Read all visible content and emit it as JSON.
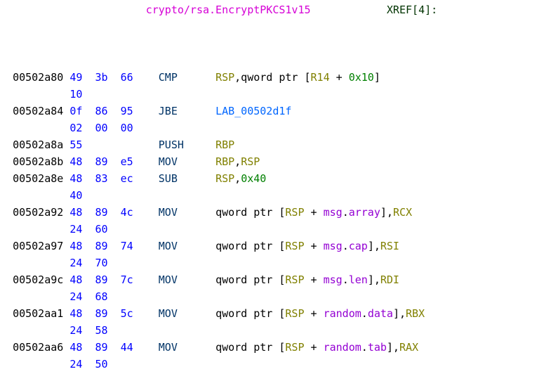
{
  "header": {
    "func_name": "crypto/rsa.EncryptPKCS1v15",
    "xref_label": "XREF[",
    "xref_count": "4",
    "xref_close": "]:"
  },
  "lines": [
    {
      "addr": "00502a80",
      "bytes1": "49  3b  66",
      "bytes2": "10",
      "mnem": "CMP",
      "ops": [
        {
          "t": "reg",
          "v": "RSP"
        },
        {
          "t": "plain",
          "v": ",qword ptr ["
        },
        {
          "t": "reg",
          "v": "R14"
        },
        {
          "t": "plain",
          "v": " + "
        },
        {
          "t": "lit",
          "v": "0x10"
        },
        {
          "t": "plain",
          "v": "]"
        }
      ]
    },
    {
      "addr": "00502a84",
      "bytes1": "0f  86  95",
      "bytes2": "02  00  00",
      "mnem": "JBE",
      "ops": [
        {
          "t": "lab",
          "v": "LAB_00502d1f"
        }
      ]
    },
    {
      "addr": "00502a8a",
      "bytes1": "55",
      "bytes2": "",
      "mnem": "PUSH",
      "ops": [
        {
          "t": "reg",
          "v": "RBP"
        }
      ]
    },
    {
      "addr": "00502a8b",
      "bytes1": "48  89  e5",
      "bytes2": "",
      "mnem": "MOV",
      "ops": [
        {
          "t": "reg",
          "v": "RBP"
        },
        {
          "t": "plain",
          "v": ","
        },
        {
          "t": "reg",
          "v": "RSP"
        }
      ]
    },
    {
      "addr": "00502a8e",
      "bytes1": "48  83  ec",
      "bytes2": "40",
      "mnem": "SUB",
      "ops": [
        {
          "t": "reg",
          "v": "RSP"
        },
        {
          "t": "plain",
          "v": ","
        },
        {
          "t": "lit",
          "v": "0x40"
        }
      ]
    },
    {
      "addr": "00502a92",
      "bytes1": "48  89  4c",
      "bytes2": "24  60",
      "mnem": "MOV",
      "ops": [
        {
          "t": "plain",
          "v": "qword ptr ["
        },
        {
          "t": "reg",
          "v": "RSP"
        },
        {
          "t": "plain",
          "v": " + "
        },
        {
          "t": "struct",
          "v": "msg"
        },
        {
          "t": "dot",
          "v": "."
        },
        {
          "t": "struct",
          "v": "array"
        },
        {
          "t": "plain",
          "v": "],"
        },
        {
          "t": "reg",
          "v": "RCX"
        }
      ]
    },
    {
      "addr": "00502a97",
      "bytes1": "48  89  74",
      "bytes2": "24  70",
      "mnem": "MOV",
      "ops": [
        {
          "t": "plain",
          "v": "qword ptr ["
        },
        {
          "t": "reg",
          "v": "RSP"
        },
        {
          "t": "plain",
          "v": " + "
        },
        {
          "t": "struct",
          "v": "msg"
        },
        {
          "t": "dot",
          "v": "."
        },
        {
          "t": "struct",
          "v": "cap"
        },
        {
          "t": "plain",
          "v": "],"
        },
        {
          "t": "reg",
          "v": "RSI"
        }
      ]
    },
    {
      "addr": "00502a9c",
      "bytes1": "48  89  7c",
      "bytes2": "24  68",
      "mnem": "MOV",
      "ops": [
        {
          "t": "plain",
          "v": "qword ptr ["
        },
        {
          "t": "reg",
          "v": "RSP"
        },
        {
          "t": "plain",
          "v": " + "
        },
        {
          "t": "struct",
          "v": "msg"
        },
        {
          "t": "dot",
          "v": "."
        },
        {
          "t": "struct",
          "v": "len"
        },
        {
          "t": "plain",
          "v": "],"
        },
        {
          "t": "reg",
          "v": "RDI"
        }
      ]
    },
    {
      "addr": "00502aa1",
      "bytes1": "48  89  5c",
      "bytes2": "24  58",
      "mnem": "MOV",
      "ops": [
        {
          "t": "plain",
          "v": "qword ptr ["
        },
        {
          "t": "reg",
          "v": "RSP"
        },
        {
          "t": "plain",
          "v": " + "
        },
        {
          "t": "struct",
          "v": "random"
        },
        {
          "t": "dot",
          "v": "."
        },
        {
          "t": "struct",
          "v": "data"
        },
        {
          "t": "plain",
          "v": "],"
        },
        {
          "t": "reg",
          "v": "RBX"
        }
      ]
    },
    {
      "addr": "00502aa6",
      "bytes1": "48  89  44",
      "bytes2": "24  50",
      "mnem": "MOV",
      "ops": [
        {
          "t": "plain",
          "v": "qword ptr ["
        },
        {
          "t": "reg",
          "v": "RSP"
        },
        {
          "t": "plain",
          "v": " + "
        },
        {
          "t": "struct",
          "v": "random"
        },
        {
          "t": "dot",
          "v": "."
        },
        {
          "t": "struct",
          "v": "tab"
        },
        {
          "t": "plain",
          "v": "],"
        },
        {
          "t": "reg",
          "v": "RAX"
        }
      ]
    }
  ]
}
